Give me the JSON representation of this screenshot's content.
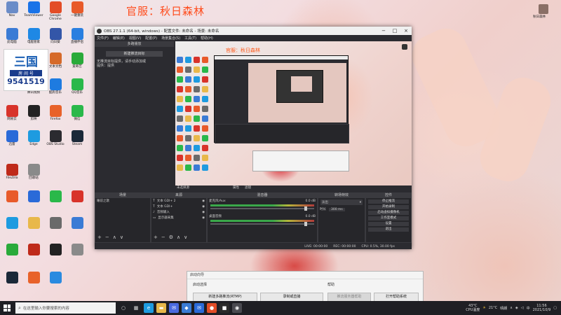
{
  "watermark": "官服：秋日森林",
  "user": {
    "name": "秋日森林"
  },
  "desktop_icons": [
    {
      "label": "Nav",
      "icon": "app-icon",
      "color": "#6a8cc8"
    },
    {
      "label": "TeamViewer",
      "icon": "teamviewer-icon",
      "color": "#1a73e8"
    },
    {
      "label": "Google Chrome",
      "icon": "chrome-icon",
      "color": "#e34c26"
    },
    {
      "label": "一键重装",
      "icon": "tool-icon",
      "color": "#e85a2a"
    },
    {
      "label": "此电脑",
      "icon": "computer-icon",
      "color": "#3a7bd5"
    },
    {
      "label": "电脑管家",
      "icon": "shield-icon",
      "color": "#1e88e5"
    },
    {
      "label": "向日葵",
      "icon": "sunflower-icon",
      "color": "#3356a8"
    },
    {
      "label": "直播伴侣",
      "icon": "music-icon",
      "color": "#2a7fe0"
    },
    {
      "label": "文件",
      "icon": "folder-icon",
      "color": "#e8b84a"
    },
    {
      "label": "文本文档",
      "icon": "doc-icon",
      "color": "#d66a2a"
    },
    {
      "label": "爱奇艺",
      "icon": "iqiyi-icon",
      "color": "#2aaa3a"
    },
    {
      "label": "腾讯视频",
      "icon": "video-icon",
      "color": "#2a8ae0"
    },
    {
      "label": "酷狗音乐",
      "icon": "kugou-icon",
      "color": "#1e7be0"
    },
    {
      "label": "QQ音乐",
      "icon": "qqmusic-icon",
      "color": "#2ab84a"
    },
    {
      "label": "网易云",
      "icon": "netease-icon",
      "color": "#d8332a"
    },
    {
      "label": "剪映",
      "icon": "cut-icon",
      "color": "#222222"
    },
    {
      "label": "Firefox",
      "icon": "firefox-icon",
      "color": "#e8622a"
    },
    {
      "label": "微信",
      "icon": "wechat-icon",
      "color": "#2ab84a"
    },
    {
      "label": "迅雷",
      "icon": "thunder-icon",
      "color": "#2a6ad8"
    },
    {
      "label": "Edge",
      "icon": "edge-icon",
      "color": "#1e9be0"
    },
    {
      "label": "OBS Studio",
      "icon": "obs-icon",
      "color": "#2b2b30"
    },
    {
      "label": "Steam",
      "icon": "steam-icon",
      "color": "#1b2838"
    },
    {
      "label": "FileZilla",
      "icon": "filezilla-icon",
      "color": "#bf2a1a"
    },
    {
      "label": "回收站",
      "icon": "recycle-icon",
      "color": "#8a8a8a"
    }
  ],
  "promo": {
    "logo": "三国",
    "label": "房 间 号",
    "number": "9541519"
  },
  "obs": {
    "title": "OBS 27.1.1 (64-bit, windows) - 配置文件: 未命名 - 场景: 未命名",
    "menu": [
      "文件(F)",
      "编辑(E)",
      "视图(V)",
      "配置(P)",
      "场景集合(S)",
      "工具(T)",
      "帮助(H)"
    ],
    "left_header": "多路播放",
    "left_button": "新建推流目标",
    "left_text": [
      "无推流目标提供，请手动添加或",
      "提供：提供"
    ],
    "preview_watermark": "官服：秋日森林",
    "scene_label": "未选择源",
    "scene_tabs": [
      "属性",
      "滤镜"
    ],
    "docks": {
      "scenes": {
        "header": "场景",
        "items": [
          "睡前之歌"
        ]
      },
      "sources": {
        "header": "来源",
        "items": [
          "文本 GDI+ 2",
          "文本 GDI+",
          "音频输入",
          "显示器采集"
        ]
      },
      "mixer": {
        "header": "混音器",
        "tracks": [
          {
            "name": "麦克风/Aux",
            "db": "0.0 dB"
          },
          {
            "name": "桌面音频",
            "db": "0.0 dB"
          }
        ]
      },
      "transitions": {
        "header": "转场特效",
        "type": "淡出",
        "duration_label": "时长",
        "duration": "300 ms"
      },
      "controls": {
        "header": "控件",
        "buttons": [
          "停止推流",
          "开始录制",
          "启动虚拟摄像机",
          "工作室模式",
          "设置",
          "退出"
        ]
      }
    },
    "status": [
      "LIVE: 00:00:00",
      "REC: 00:00:00",
      "CPU: 0.5%, 30.00 fps"
    ]
  },
  "startup": {
    "title": "启动向导",
    "left_section": "启动选择",
    "right_section": "帮助",
    "buttons": [
      "新建多路推流(RTMP)",
      "录制或直播",
      "推流服务器帮助",
      "打开帮助系统"
    ]
  },
  "taskbar": {
    "search_placeholder": "在这里输入你要搜索的内容",
    "weather_temp": "43°C",
    "weather_label": "CPU温度",
    "temp": "21°C",
    "temp_label": "晴朗",
    "lang": "中",
    "time": "11:56",
    "date": "2021/10/9"
  }
}
